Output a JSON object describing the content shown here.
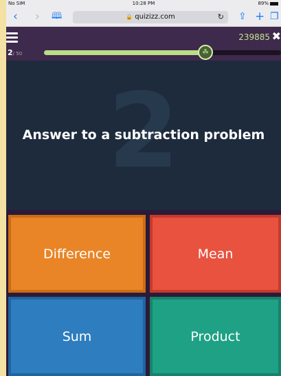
{
  "status_bar": {
    "carrier": "No SIM",
    "time": "10:28 PM",
    "battery": "89%"
  },
  "browser": {
    "url": "quizizz.com",
    "icons": [
      "back-icon",
      "forward-icon",
      "bookmarks-icon",
      "reload-icon",
      "share-icon",
      "new-tab-icon",
      "tabs-icon"
    ]
  },
  "game": {
    "score": "239885",
    "question_number": "2",
    "question_total": "/ 50",
    "progress": 0.68
  },
  "question": {
    "number_watermark": "2",
    "text": "Answer to a subtraction problem"
  },
  "answers": [
    {
      "label": "Difference",
      "color": "#e98526"
    },
    {
      "label": "Mean",
      "color": "#e8523f"
    },
    {
      "label": "Sum",
      "color": "#2d7dbf"
    },
    {
      "label": "Product",
      "color": "#1fa185"
    }
  ],
  "colors": {
    "page_background": "#2b1a38",
    "header": "#3e2a4c",
    "progress_fill": "#b9de86",
    "question_background": "#1d2b3c"
  }
}
